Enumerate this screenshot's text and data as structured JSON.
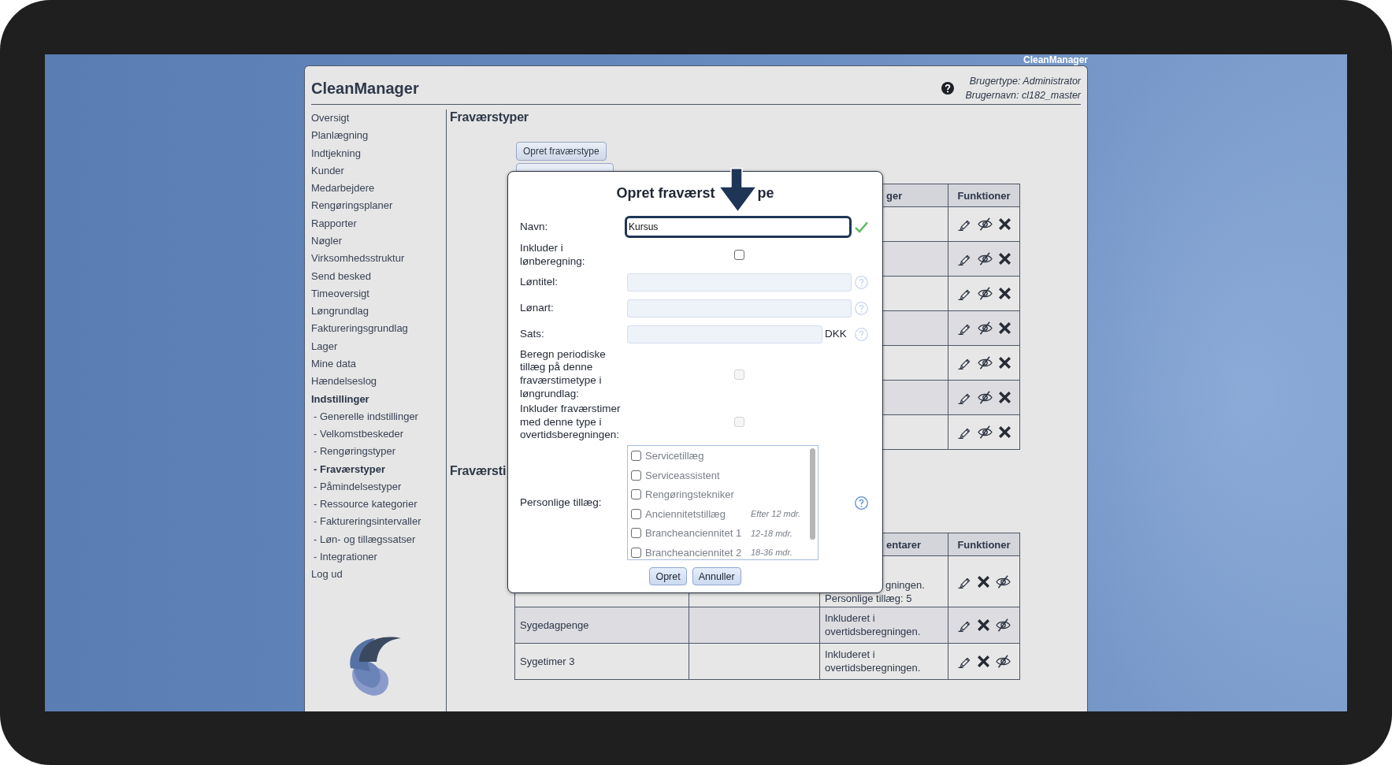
{
  "window": {
    "title": "CleanManager"
  },
  "header": {
    "app_name": "CleanManager",
    "user_type": "Brugertype: Administrator",
    "user_name": "Brugernavn: cl182_master"
  },
  "sidebar": {
    "items": [
      {
        "label": "Oversigt",
        "selected": false
      },
      {
        "label": "Planlægning",
        "selected": false
      },
      {
        "label": "Indtjekning",
        "selected": false
      },
      {
        "label": "Kunder",
        "selected": false
      },
      {
        "label": "Medarbejdere",
        "selected": false
      },
      {
        "label": "Rengøringsplaner",
        "selected": false
      },
      {
        "label": "Rapporter",
        "selected": false
      },
      {
        "label": "Nøgler",
        "selected": false
      },
      {
        "label": "Virksomhedsstruktur",
        "selected": false
      },
      {
        "label": "Send besked",
        "selected": false
      },
      {
        "label": "Timeoversigt",
        "selected": false
      },
      {
        "label": "Løngrundlag",
        "selected": false
      },
      {
        "label": "Faktureringsgrundlag",
        "selected": false
      },
      {
        "label": "Lager",
        "selected": false
      },
      {
        "label": "Mine data",
        "selected": false
      },
      {
        "label": "Hændelseslog",
        "selected": false
      },
      {
        "label": "Indstillinger",
        "selected": true,
        "expanded": true,
        "children": [
          {
            "label": "- Generelle indstillinger",
            "selected": false
          },
          {
            "label": "- Velkomstbeskeder",
            "selected": false
          },
          {
            "label": "- Rengøringstyper",
            "selected": false
          },
          {
            "label": "- Fraværstyper",
            "selected": true
          },
          {
            "label": "- Påmindelsestyper",
            "selected": false
          },
          {
            "label": "- Ressource kategorier",
            "selected": false
          },
          {
            "label": "- Faktureringsintervaller",
            "selected": false
          },
          {
            "label": "- Løn- og tillægssatser",
            "selected": false
          },
          {
            "label": "- Integrationer",
            "selected": false
          }
        ]
      },
      {
        "label": "Log ud",
        "selected": false
      }
    ]
  },
  "main": {
    "heading": "Fraværstyper",
    "buttons": [
      {
        "label": "Opret fraværstype",
        "covered": false
      },
      {
        "covered": true
      }
    ],
    "table": {
      "headers": {
        "column_3": "ger",
        "functions": "Funktioner"
      },
      "rows": [
        {
          "actions": [
            {
              "kind": "edit"
            },
            {
              "kind": "hide"
            },
            {
              "kind": "delete"
            }
          ]
        },
        {
          "actions": [
            {
              "kind": "edit"
            },
            {
              "kind": "hide"
            },
            {
              "kind": "delete"
            }
          ]
        },
        {
          "actions": [
            {
              "kind": "edit"
            },
            {
              "kind": "hide"
            },
            {
              "kind": "delete"
            }
          ]
        },
        {
          "actions": [
            {
              "kind": "edit"
            },
            {
              "kind": "hide"
            },
            {
              "kind": "delete"
            }
          ]
        },
        {
          "actions": [
            {
              "kind": "edit"
            },
            {
              "kind": "hide"
            },
            {
              "kind": "delete"
            }
          ]
        },
        {
          "actions": [
            {
              "kind": "edit"
            },
            {
              "kind": "hide"
            },
            {
              "kind": "delete"
            }
          ]
        },
        {
          "actions": [
            {
              "kind": "edit"
            },
            {
              "kind": "hide"
            },
            {
              "kind": "delete"
            }
          ]
        }
      ]
    },
    "section_heading": "Fraværsti",
    "lower_table": {
      "headers": {
        "column_3": "entarer",
        "functions": "Funktioner"
      },
      "rows": [
        {
          "column_3": [
            "gningen.",
            "Personlige tillæg: 5"
          ],
          "actions": [
            {
              "kind": "edit"
            },
            {
              "kind": "delete"
            },
            {
              "kind": "hide"
            }
          ]
        },
        {
          "column_1": "Sygedagpenge",
          "column_3": "Inkluderet i overtidsberegningen.",
          "actions": [
            {
              "kind": "edit"
            },
            {
              "kind": "delete"
            },
            {
              "kind": "hide"
            }
          ]
        },
        {
          "column_1": "Sygetimer 3",
          "column_3": "Inkluderet i overtidsberegningen.",
          "actions": [
            {
              "kind": "edit"
            },
            {
              "kind": "delete"
            },
            {
              "kind": "hide"
            }
          ]
        }
      ]
    }
  },
  "dialog": {
    "title_start": "Opret fraværst",
    "title_end": "pe",
    "fields": [
      {
        "kind": "text",
        "label": "Navn:",
        "value": "Kursus",
        "disabled": false,
        "highlighted": true,
        "valid": true,
        "help": false
      },
      {
        "kind": "checkbox",
        "label": "Inkluder i lønberegning:",
        "checked": false,
        "disabled": false,
        "highlighted": false,
        "valid": false,
        "help": false
      },
      {
        "kind": "text",
        "label": "Løntitel:",
        "disabled": true,
        "highlighted": false,
        "valid": false,
        "help": true
      },
      {
        "kind": "text",
        "label": "Lønart:",
        "disabled": true,
        "highlighted": false,
        "valid": false,
        "help": true
      },
      {
        "kind": "text",
        "label": "Sats:",
        "unit": "DKK",
        "disabled": true,
        "highlighted": false,
        "valid": false,
        "help": true
      },
      {
        "kind": "checkbox",
        "label": "Beregn periodiske tillæg på denne fraværstimetype i løngrundlag:",
        "checked": false,
        "disabled": true,
        "highlighted": false,
        "valid": false,
        "help": false
      },
      {
        "kind": "checkbox",
        "label": "Inkluder fraværstimer med denne type i overtidsberegningen:",
        "checked": false,
        "disabled": true,
        "highlighted": false,
        "valid": false,
        "help": false
      },
      {
        "kind": "checklist",
        "label": "Personlige tillæg:",
        "disabled": false,
        "highlighted": false,
        "valid": false,
        "help": true,
        "options": [
          {
            "label": "Servicetillæg",
            "checked": false
          },
          {
            "label": "Serviceassistent",
            "checked": false
          },
          {
            "label": "Rengøringstekniker",
            "checked": false
          },
          {
            "label": "Anciennitetstillæg",
            "note": "Efter 12 mdr.",
            "checked": false
          },
          {
            "label": "Brancheanciennitet 1",
            "note": "12-18 mdr.",
            "checked": false
          },
          {
            "label": "Brancheanciennitet 2",
            "note": "18-36 mdr.",
            "checked": false
          }
        ]
      }
    ],
    "buttons": [
      {
        "label": "Opret"
      },
      {
        "label": "Annuller"
      }
    ]
  }
}
